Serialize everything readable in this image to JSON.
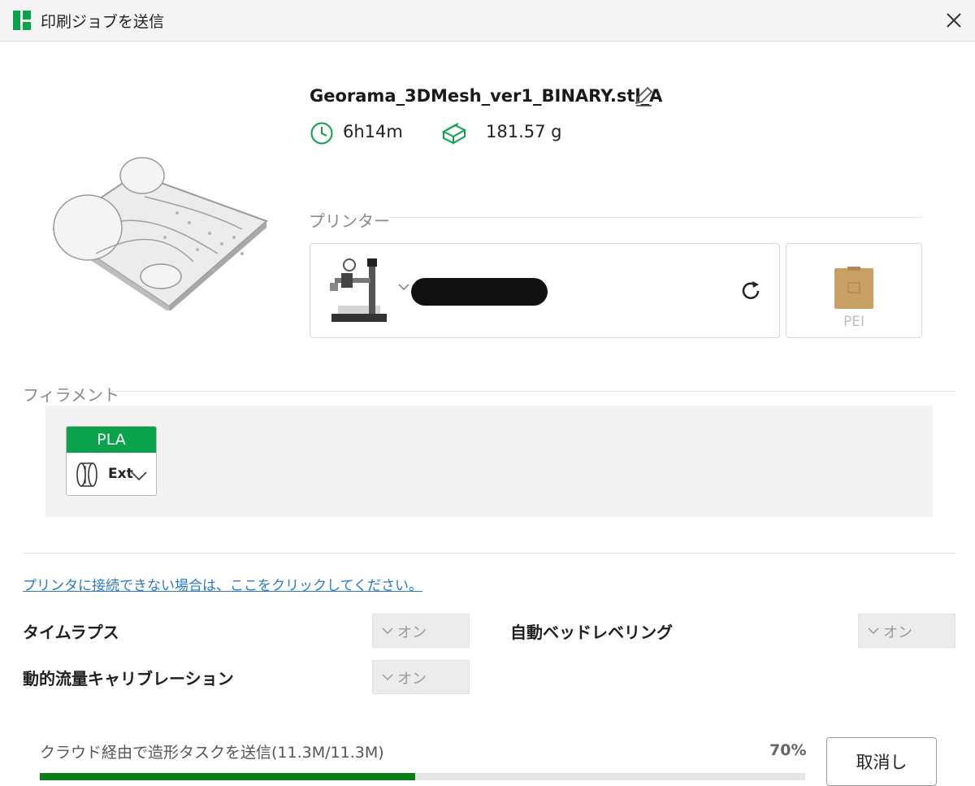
{
  "window": {
    "title": "印刷ジョブを送信",
    "app_icon": "bambu-logo-icon",
    "close_icon": "close-icon"
  },
  "job": {
    "file_name": "Georama_3DMesh_ver1_BINARY.stl_A",
    "time": "6h14m",
    "weight": "181.57 g"
  },
  "printer_section": {
    "label": "プリンター",
    "plate_label": "PEI",
    "plate_color": "#c8a064"
  },
  "filament_section": {
    "label": "フィラメント",
    "card": {
      "type": "PLA",
      "slot": "Ext",
      "color": "#0aa24a"
    }
  },
  "link": {
    "text": "プリンタに接続できない場合は、ここをクリックしてください。"
  },
  "options": {
    "timelapse": {
      "label": "タイムラプス",
      "value": "オン"
    },
    "bed_leveling": {
      "label": "自動ベッドレベリング",
      "value": "オン"
    },
    "flow_calibration": {
      "label": "動的流量キャリブレーション",
      "value": "オン"
    }
  },
  "progress": {
    "label": "クラウド経由で造形タスクを送信(11.3M/11.3M)",
    "percent_text": "70%",
    "fill_fraction": 0.49,
    "color": "#0d7d1a"
  },
  "cancel_label": "取消し"
}
